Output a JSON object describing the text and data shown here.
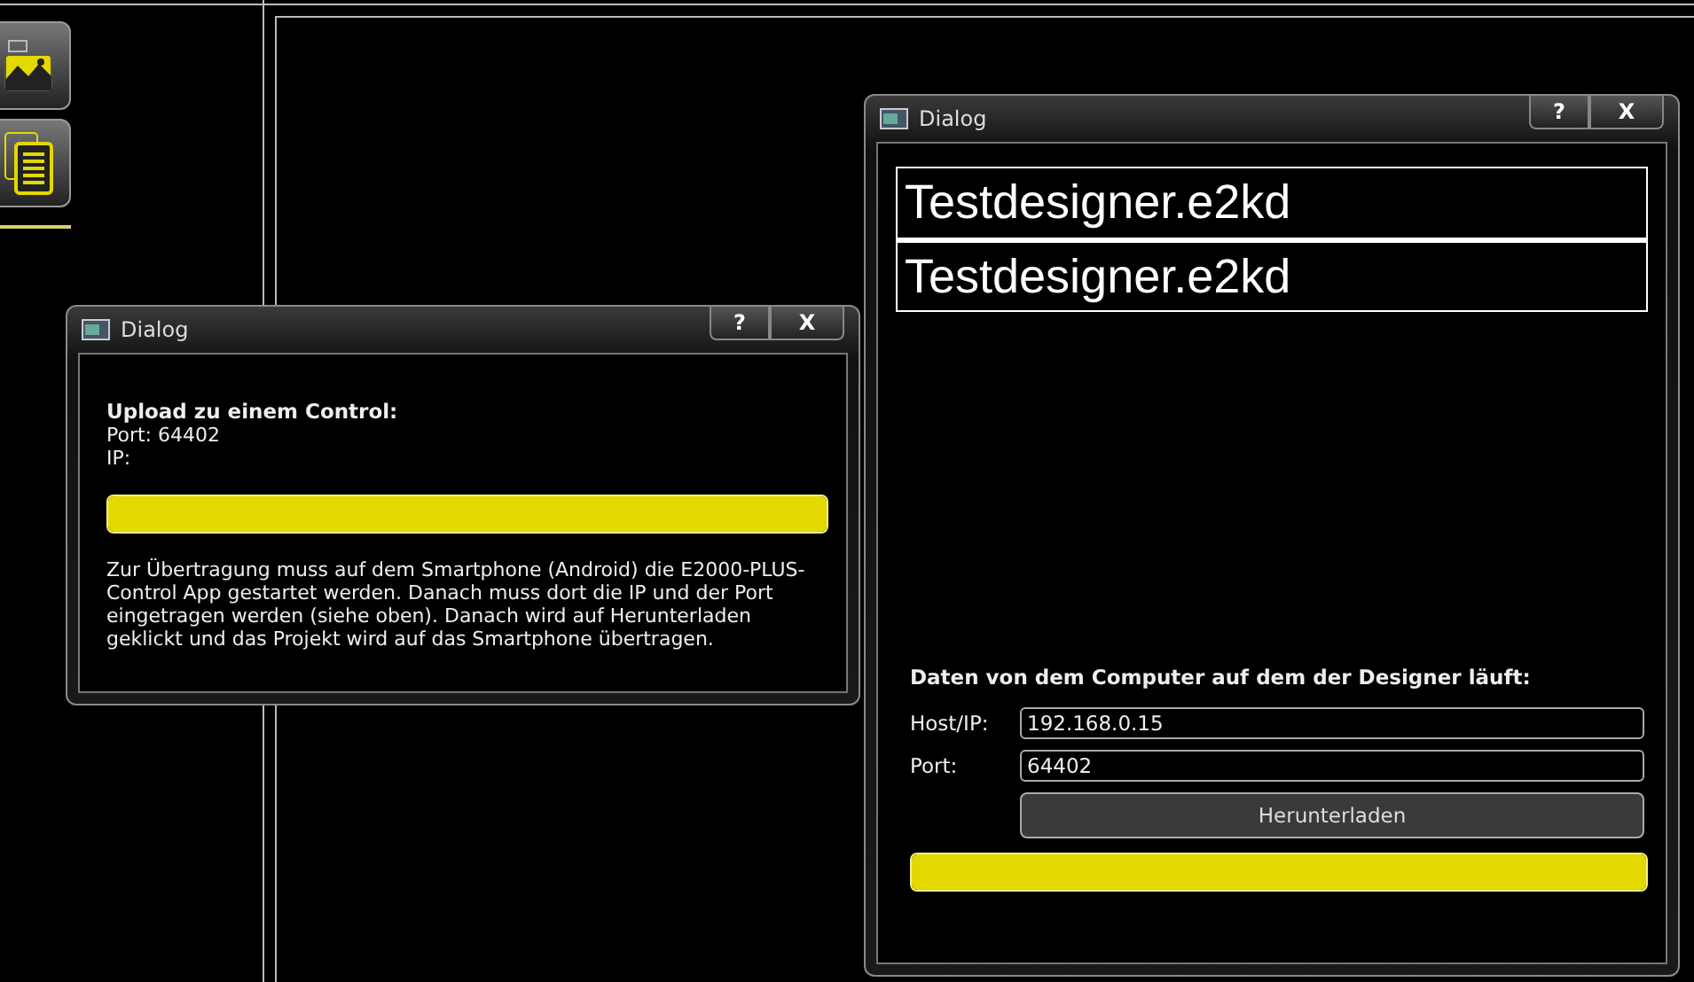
{
  "left_dialog": {
    "title": "Dialog",
    "help_button": "?",
    "close_button": "X",
    "heading": "Upload zu einem Control:",
    "port_line": "Port: 64402",
    "ip_line": "IP:",
    "progress": {
      "level": 1
    },
    "description": "Zur Übertragung muss auf dem Smartphone (Android) die E2000-PLUS-Control App gestartet werden. Danach muss dort die IP und der Port eingetragen werden (siehe oben). Danach wird auf Herunterladen geklickt und das Projekt wird auf das Smartphone übertragen."
  },
  "right_dialog": {
    "title": "Dialog",
    "help_button": "?",
    "close_button": "X",
    "files": [
      {
        "name": "Testdesigner.e2kd"
      },
      {
        "name": "Testdesigner.e2kd"
      }
    ],
    "section_title": "Daten von dem Computer auf dem der Designer läuft:",
    "fields": [
      {
        "label": "Host/IP:",
        "value": "192.168.0.15"
      },
      {
        "label": "Port:",
        "value": "64402"
      }
    ],
    "download_button": "Herunterladen",
    "progress": {
      "level": 1
    }
  }
}
